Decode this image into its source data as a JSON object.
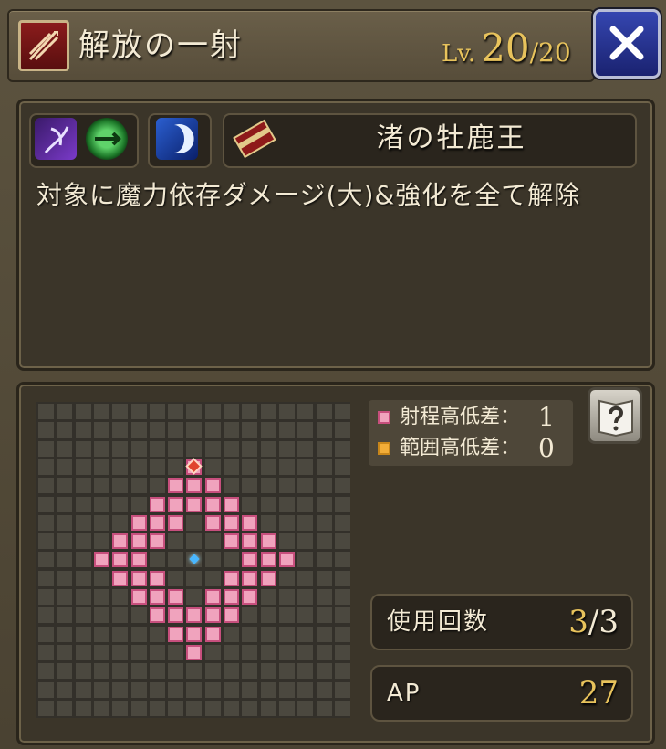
{
  "header": {
    "skill_name": "解放の一射",
    "level_prefix": "Lv.",
    "level": "20",
    "level_max": "/20"
  },
  "info": {
    "icons": [
      "arcane-bow-icon",
      "green-arrow-icon",
      "crescent-moon-icon"
    ],
    "unit_name": "渚の牡鹿王",
    "description": "対象に魔力依存ダメージ(大)&強化を全て解除"
  },
  "range": {
    "legend": [
      {
        "label": "射程高低差：",
        "value": "1",
        "color": "#f0a3bd"
      },
      {
        "label": "範囲高低差：",
        "value": "0",
        "color": "#f2ad38"
      }
    ]
  },
  "stats": {
    "uses_label": "使用回数",
    "uses_current": "3",
    "uses_max": "/3",
    "ap_label": "AP",
    "ap_value": "27"
  },
  "colors": {
    "accent_gold": "#e8c35c",
    "range_pink": "#f0a3bd",
    "close_blue": "#2b3aa0"
  }
}
